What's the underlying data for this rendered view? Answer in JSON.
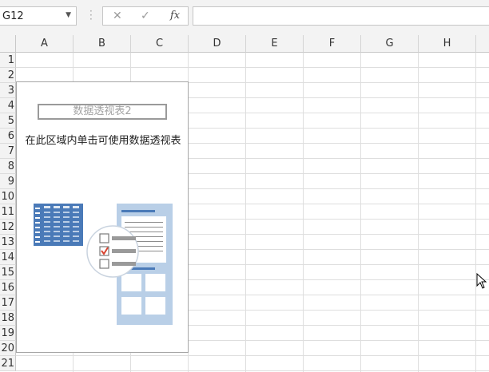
{
  "formula_bar": {
    "name_box_value": "G12",
    "cancel_icon": "close-icon",
    "enter_icon": "check-icon",
    "fx_label": "fx",
    "formula_value": ""
  },
  "columns": [
    "A",
    "B",
    "C",
    "D",
    "E",
    "F",
    "G",
    "H"
  ],
  "rows": [
    "1",
    "2",
    "3",
    "4",
    "5",
    "6",
    "7",
    "8",
    "9",
    "10",
    "11",
    "12",
    "13",
    "14",
    "15",
    "16",
    "17",
    "18",
    "19",
    "20",
    "21"
  ],
  "pivot": {
    "name": "数据透视表2",
    "hint": "在此区域内单击可使用数据透视表"
  },
  "colors": {
    "pivot_blue": "#4a7ab8",
    "panel_light_blue": "#b9cfe7",
    "check_red": "#d9422e"
  }
}
